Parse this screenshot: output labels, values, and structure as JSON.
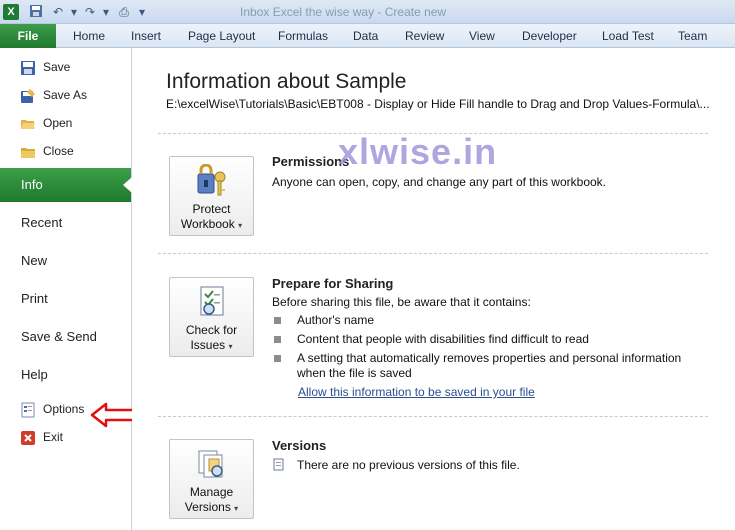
{
  "titlebar": {
    "title": "Inbox Excel the wise way - Create new"
  },
  "ribbon": {
    "file": "File",
    "tabs": [
      "Home",
      "Insert",
      "Page Layout",
      "Formulas",
      "Data",
      "Review",
      "View",
      "Developer",
      "Load Test",
      "Team"
    ]
  },
  "nav": {
    "save": "Save",
    "save_as": "Save As",
    "open": "Open",
    "close": "Close",
    "info": "Info",
    "recent": "Recent",
    "new": "New",
    "print": "Print",
    "save_send": "Save & Send",
    "help": "Help",
    "options": "Options",
    "exit": "Exit"
  },
  "main": {
    "title": "Information about Sample",
    "path": "E:\\excelWise\\Tutorials\\Basic\\EBT008 - Display or Hide Fill handle to Drag and Drop Values-Formula\\...",
    "watermark": "xlwise.in",
    "permissions": {
      "btn_line1": "Protect",
      "btn_line2": "Workbook",
      "heading": "Permissions",
      "text": "Anyone can open, copy, and change any part of this workbook."
    },
    "sharing": {
      "btn_line1": "Check for",
      "btn_line2": "Issues",
      "heading": "Prepare for Sharing",
      "text": "Before sharing this file, be aware that it contains:",
      "bullets": [
        "Author's name",
        "Content that people with disabilities find difficult to read",
        "A setting that automatically removes properties and personal information",
        "when the file is saved"
      ],
      "link": "Allow this information to be saved in your file"
    },
    "versions": {
      "btn_line1": "Manage",
      "btn_line2": "Versions",
      "heading": "Versions",
      "text": "There are no previous versions of this file."
    }
  },
  "colors": {
    "file_green": "#1f7a2d",
    "info_green": "#3d9e48",
    "annotation_red": "#e01010",
    "link_blue": "#2a4f8f"
  }
}
